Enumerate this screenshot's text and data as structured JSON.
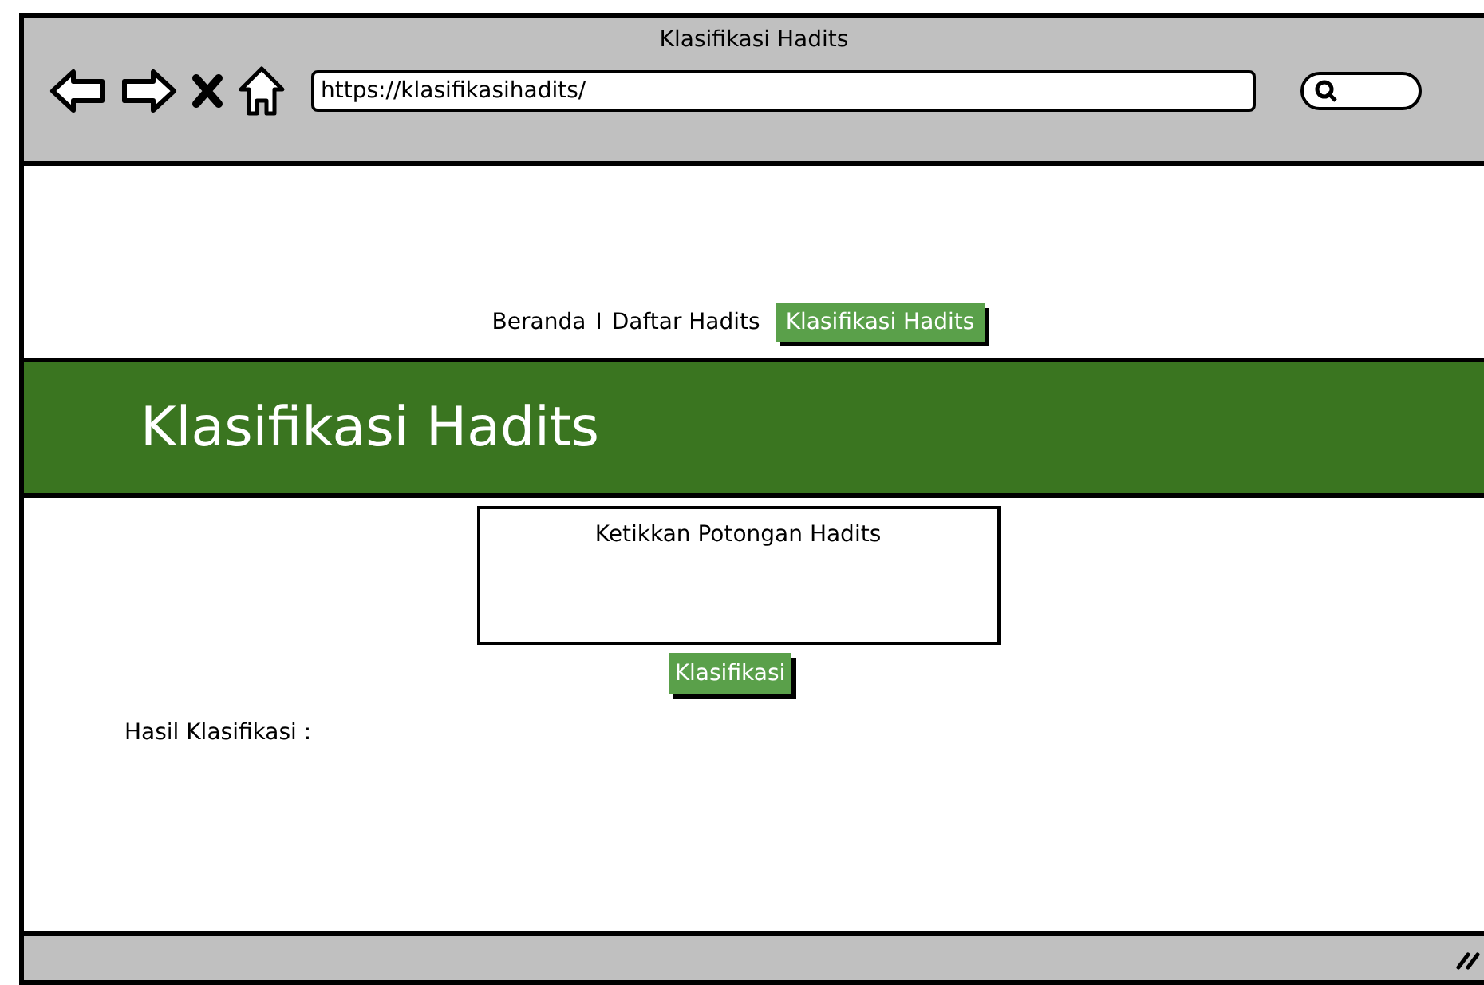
{
  "window": {
    "title": "Klasifikasi Hadits"
  },
  "toolbar": {
    "url": "https://klasifikasihadits/"
  },
  "nav": [
    {
      "kind": "link",
      "label": "Beranda",
      "selected": false
    },
    {
      "kind": "separator",
      "label": "I"
    },
    {
      "kind": "link",
      "label": "Daftar Hadits",
      "selected": false
    },
    {
      "kind": "link",
      "label": "Klasifikasi Hadits",
      "selected": true
    }
  ],
  "banner": {
    "title": "Klasifikasi Hadits"
  },
  "input": {
    "placeholder": "Ketikkan Potongan Hadits"
  },
  "button": {
    "label": "Klasifikasi"
  },
  "result": {
    "label": "Hasil Klasifikasi :"
  }
}
